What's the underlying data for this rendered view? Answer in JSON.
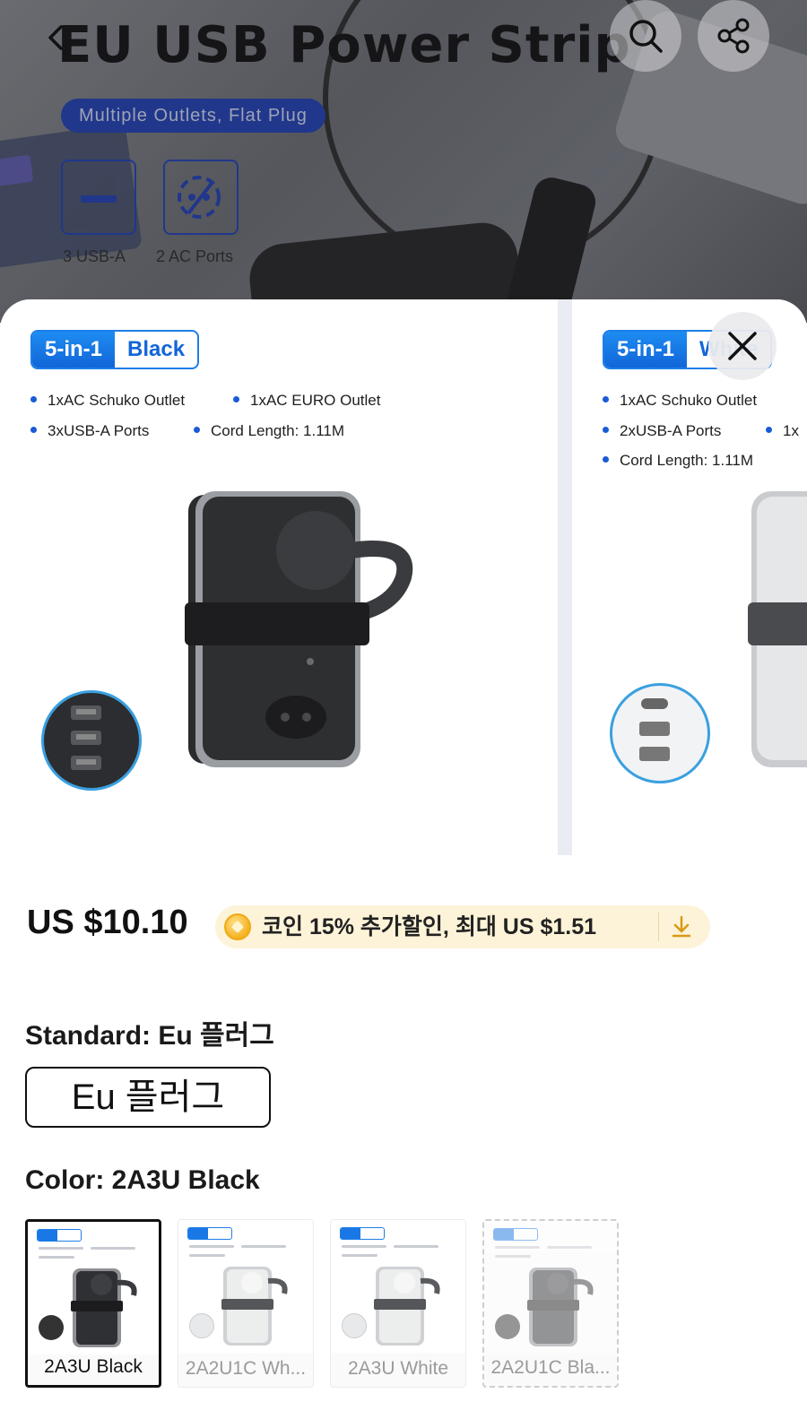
{
  "hero": {
    "title": "EU USB Power Strip",
    "subtitle": "Multiple Outlets, Flat Plug",
    "features": [
      {
        "label": "3 USB-A"
      },
      {
        "label": "2 AC Ports"
      }
    ]
  },
  "nav_icons": [
    "back-icon",
    "search-icon",
    "share-icon"
  ],
  "viewer": {
    "slides": [
      {
        "badge_left": "5-in-1",
        "badge_right": "Black",
        "specs": [
          "1xAC Schuko Outlet",
          "1xAC EURO Outlet",
          "3xUSB-A Ports",
          "Cord Length: 1.11M"
        ]
      },
      {
        "badge_left": "5-in-1",
        "badge_right": "White",
        "specs": [
          "1xAC Schuko Outlet",
          "2xUSB-A Ports",
          "1x",
          "Cord Length: 1.11M"
        ]
      }
    ]
  },
  "price": {
    "amount": "US $10.10",
    "coin_offer": "코인 15% 추가할인, 최대 US $1.51"
  },
  "standard": {
    "label": "Standard: Eu 플러그",
    "selected_option": "Eu 플러그"
  },
  "color": {
    "label": "Color: 2A3U Black",
    "options": [
      {
        "label": "2A3U Black",
        "state": "selected"
      },
      {
        "label": "2A2U1C Wh...",
        "state": "available"
      },
      {
        "label": "2A3U White",
        "state": "available"
      },
      {
        "label": "2A2U1C Bla...",
        "state": "unavailable"
      }
    ]
  },
  "colors": {
    "accent_blue": "#1266d8",
    "coin_pill_bg": "#fdf3d8",
    "selected_border": "#111111"
  }
}
